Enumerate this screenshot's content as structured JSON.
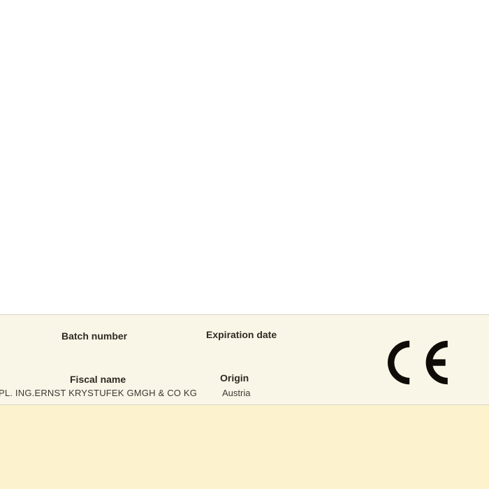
{
  "info": {
    "batch_label": "Batch number",
    "batch_value": "",
    "expiry_label": "Expiration date",
    "expiry_value": "",
    "fiscal_label": "Fiscal name",
    "fiscal_value": "PL. ING.ERNST KRYSTUFEK GMGH & CO KG",
    "origin_label": "Origin",
    "origin_value": "Austria"
  }
}
